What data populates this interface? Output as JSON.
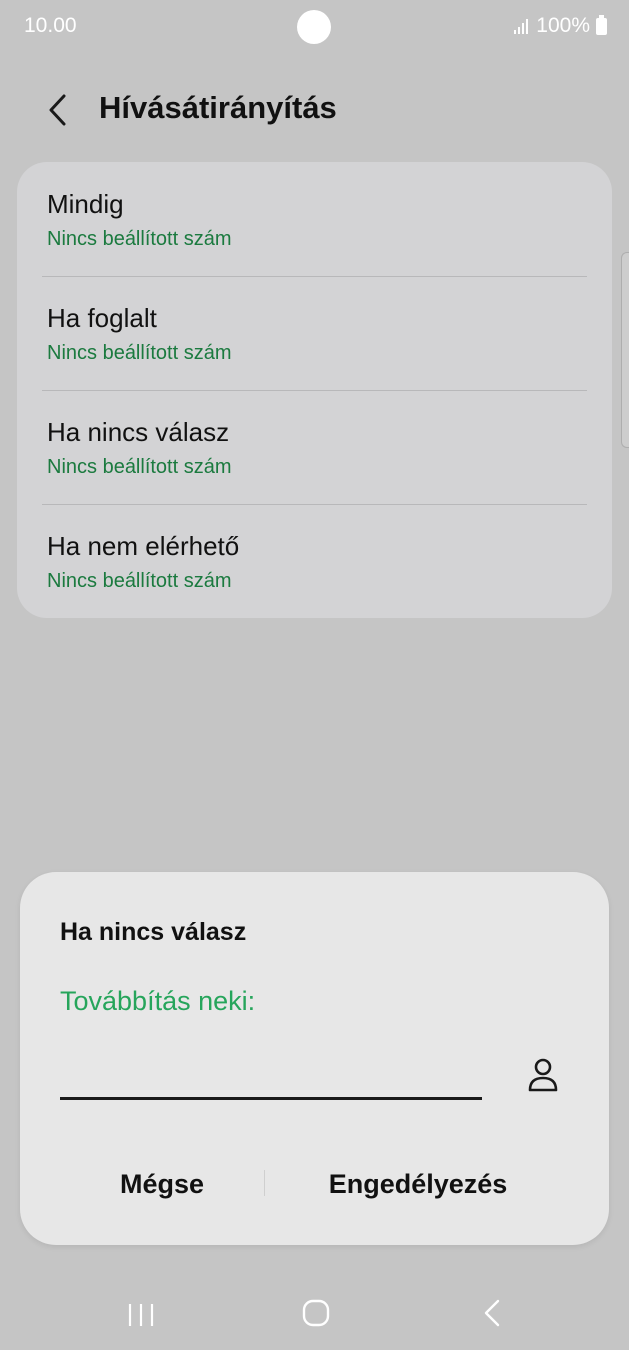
{
  "status_bar": {
    "time": "10.00",
    "battery": "100%",
    "icons": [
      "signal-icon",
      "battery-icon",
      "camera-cutout"
    ]
  },
  "header": {
    "back_icon": "chevron-left-icon",
    "title": "Hívásátirányítás"
  },
  "forwarding_options": [
    {
      "title": "Mindig",
      "subtitle": "Nincs beállított szám"
    },
    {
      "title": "Ha foglalt",
      "subtitle": "Nincs beállított szám"
    },
    {
      "title": "Ha nincs válasz",
      "subtitle": "Nincs beállított szám"
    },
    {
      "title": "Ha nem elérhető",
      "subtitle": "Nincs beállított szám"
    }
  ],
  "dialog": {
    "title": "Ha nincs válasz",
    "field_label": "Továbbítás neki:",
    "number_value": "",
    "contact_icon": "person-icon",
    "cancel_label": "Mégse",
    "enable_label": "Engedélyezés"
  },
  "nav_bar": {
    "icons": [
      "recents-icon",
      "home-icon",
      "back-icon"
    ]
  },
  "colors": {
    "background": "#c5c5c5",
    "card": "#d3d3d5",
    "subtitle_green": "#1b7a3f",
    "accent_green": "#26a55b",
    "dialog": "#e7e7e7"
  }
}
